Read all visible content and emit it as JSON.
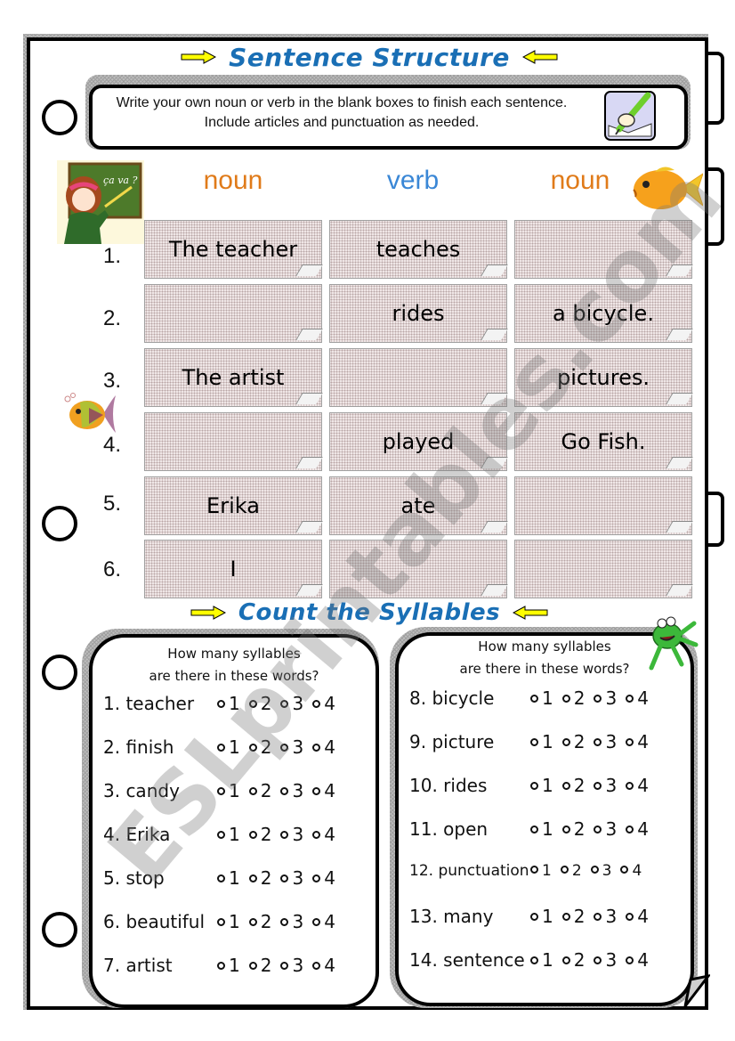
{
  "title": "Sentence Structure",
  "instructions": "Write your own noun or verb in the blank boxes to finish each sentence. Include articles and punctuation as needed.",
  "icons": {
    "arrow_right": "yellow-arrow-right-icon",
    "arrow_left": "yellow-arrow-left-icon",
    "pen": "pen-writing-icon",
    "teacher": "teacher-clipart",
    "gold_fish": "gold-fish-clipart",
    "rainbow_fish": "rainbow-fish-clipart",
    "frog": "frog-clipart"
  },
  "columns": [
    {
      "label": "noun",
      "color": "#e07b1a"
    },
    {
      "label": "verb",
      "color": "#3a87d6"
    },
    {
      "label": "noun",
      "color": "#e07b1a"
    }
  ],
  "sentences": [
    {
      "num": "1.",
      "cells": [
        "The teacher",
        "teaches",
        ""
      ]
    },
    {
      "num": "2.",
      "cells": [
        "",
        "rides",
        "a bicycle."
      ]
    },
    {
      "num": "3.",
      "cells": [
        "The artist",
        "",
        "pictures."
      ]
    },
    {
      "num": "4.",
      "cells": [
        "",
        "played",
        "Go Fish."
      ]
    },
    {
      "num": "5.",
      "cells": [
        "Erika",
        "ate",
        ""
      ]
    },
    {
      "num": "6.",
      "cells": [
        "I",
        "",
        ""
      ]
    }
  ],
  "syllables": {
    "title": "Count the Syllables",
    "question_line1": "How many syllables",
    "question_line2": "are there in these words?",
    "options": [
      "1",
      "2",
      "3",
      "4"
    ],
    "left_words": [
      "1. teacher",
      "2. finish",
      "3. candy",
      "4. Erika",
      "5. stop",
      "6. beautiful",
      "7. artist"
    ],
    "right_words": [
      "8. bicycle",
      "9. picture",
      "10. rides",
      "11. open",
      "12. punctuation",
      "13. many",
      "14. sentence"
    ]
  },
  "watermark": "ESLprintables.com",
  "colors": {
    "title_blue": "#1a6fb5",
    "arrow_yellow": "#ffff00",
    "card_bg": "#efe6e6"
  }
}
